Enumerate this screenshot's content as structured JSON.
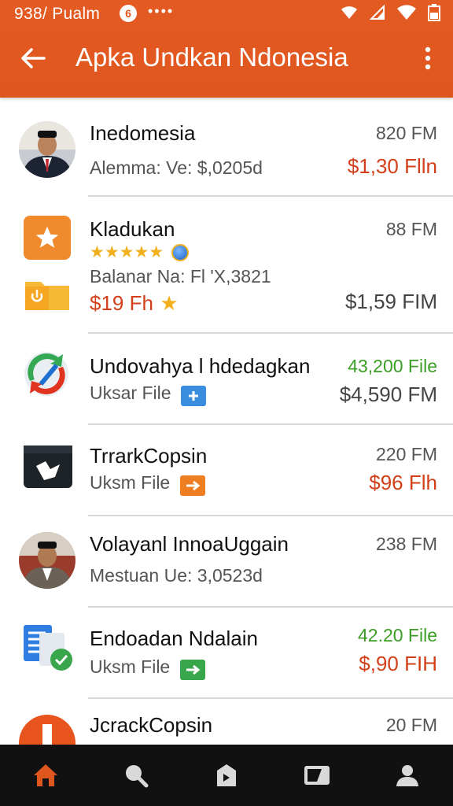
{
  "status_bar": {
    "time": "938/ Pualm",
    "badge": "6",
    "dots": "••••"
  },
  "header": {
    "title": "Apka Undkan Ndonesia"
  },
  "items": [
    {
      "title": "Inedomesia",
      "subtitle": "Alemma: Ve: $,0205d",
      "size": "820 FM",
      "price": "$1,30 Flln"
    },
    {
      "title": "Kladukan",
      "rating_stars": "★★★★★",
      "subtitle": "Balanar Na: Fl 'X,3821",
      "secondary_price": "$19 Fh",
      "size": "88 FM",
      "price": "$1,59 FIM"
    },
    {
      "title": "Undovahya l hdedagkan",
      "subtitle": "Uksar File",
      "size": "43,200 File",
      "price": "$4,590 FM"
    },
    {
      "title": "TrrarkCopsin",
      "subtitle": "Uksm File",
      "size": "220 FM",
      "price": "$96 Flh"
    },
    {
      "title": "Volayanl InnoaUggain",
      "subtitle": "Mestuan Ue: 3,0523d",
      "size": "238 FM",
      "price": ""
    },
    {
      "title": "Endoadan Ndalain",
      "subtitle": "Uksm File",
      "size": "42.20 File",
      "price": "$,90 FIH"
    },
    {
      "title": "JcrackCopsin",
      "subtitle": "",
      "size": "20 FM",
      "price": ""
    }
  ],
  "colors": {
    "accent": "#e0561f",
    "price": "#d2401a",
    "green": "#3a9e25",
    "nav_bg": "#111111",
    "nav_active": "#e0561f"
  },
  "bottom_nav": [
    {
      "icon": "home-icon",
      "active": true
    },
    {
      "icon": "search-icon",
      "active": false
    },
    {
      "icon": "tag-icon",
      "active": false
    },
    {
      "icon": "tablet-icon",
      "active": false
    },
    {
      "icon": "profile-icon",
      "active": false
    }
  ]
}
